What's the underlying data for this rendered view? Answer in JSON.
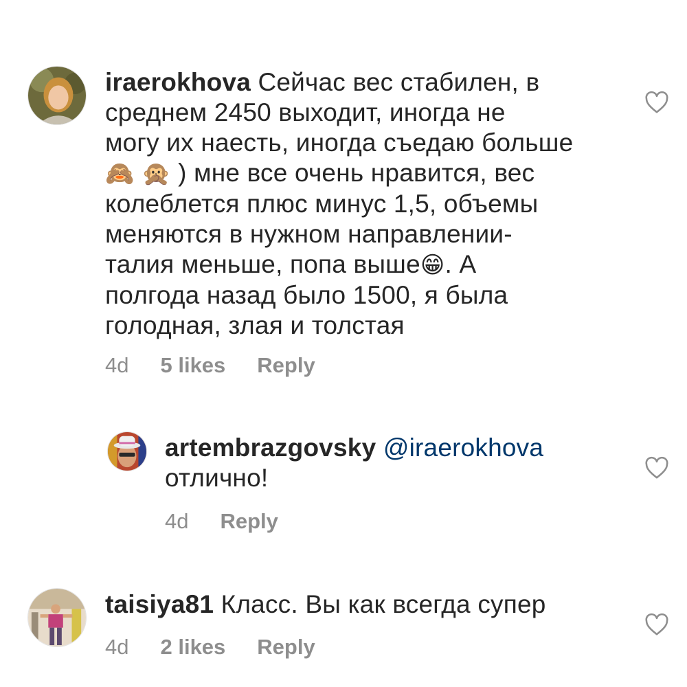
{
  "comments": [
    {
      "username": "iraerokhova",
      "lines": [
        "Сейчас вес стабилен, в",
        "среднем 2450 выходит, иногда не",
        "могу их наесть, иногда съедаю больше",
        ") мне все очень нравится, вес",
        "колеблется плюс минус 1,5, объемы",
        "меняются в нужном направлении-",
        "талия меньше, попа выше",
        ". А",
        "полгода назад было 1500, я была",
        "голодная, злая и толстая"
      ],
      "emoji": [
        "🙈",
        "🙊",
        "😁"
      ],
      "time": "4d",
      "likes": "5 likes",
      "reply": "Reply",
      "avatar_icon": "user-photo-woman"
    },
    {
      "username": "artembrazgovsky",
      "mention": "@iraerokhova",
      "lines": [
        "отлично!"
      ],
      "time": "4d",
      "reply": "Reply",
      "avatar_icon": "user-photo-man-hat"
    },
    {
      "username": "taisiya81",
      "lines": [
        "Класс. Вы как всегда супер"
      ],
      "time": "4d",
      "likes": "2 likes",
      "reply": "Reply",
      "avatar_icon": "user-photo-gym"
    }
  ],
  "colors": {
    "text": "#262626",
    "secondary": "#8e8e8e",
    "mention": "#00376b",
    "heart_stroke": "#8e8e8e"
  }
}
